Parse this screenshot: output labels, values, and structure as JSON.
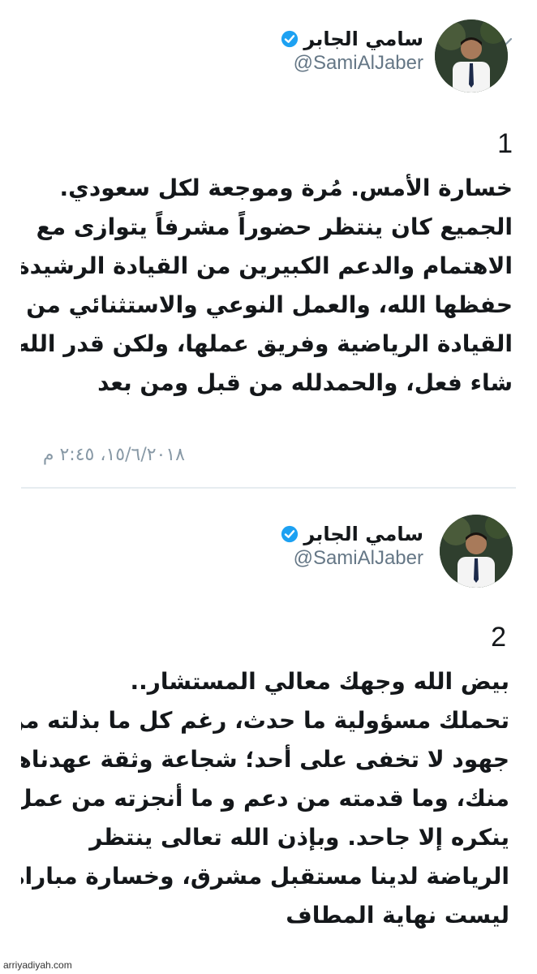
{
  "tweets": [
    {
      "author": {
        "display_name": "سامي الجابر",
        "handle": "@SamiAlJaber",
        "verified": true
      },
      "number": "1",
      "lines": [
        "خسارة الأمس. مُرة وموجعة لكل سعودي.",
        "الجميع كان ينتظر حضوراً مشرفاً يتوازى مع",
        "الاهتمام والدعم الكبيرين من القيادة الرشيدة",
        "حفظها الله، والعمل النوعي والاستثنائي من",
        "القيادة الرياضية وفريق عملها، ولكن قدر الله وما",
        "شاء فعل، والحمدلله من قبل ومن بعد"
      ],
      "timestamp": "١٥/٦/٢٠١٨، ٢:٤٥ م"
    },
    {
      "author": {
        "display_name": "سامي الجابر",
        "handle": "@SamiAlJaber",
        "verified": true
      },
      "number": "2",
      "lines": [
        "بيض الله وجهك معالي المستشار..",
        "تحملك مسؤولية ما حدث، رغم كل ما بذلته من",
        "جهود لا تخفى على أحد؛ شجاعة وثقة عهدناها",
        "منك، وما قدمته من دعم و ما أنجزته من عمل لا",
        "ينكره إلا جاحد. وبإذن الله تعالى ينتظر",
        "الرياضة لدينا مستقبل مشرق، وخسارة مباراة",
        "ليست نهاية المطاف"
      ]
    }
  ],
  "watermark": "arriyadiyah.com",
  "colors": {
    "verified_blue": "#1da1f2",
    "secondary_text": "#657786",
    "timestamp_gray": "#8899a6",
    "divider": "#e6ecf0"
  },
  "icons": {
    "menu": "chevron-down-icon",
    "verified": "verified-badge-icon"
  }
}
